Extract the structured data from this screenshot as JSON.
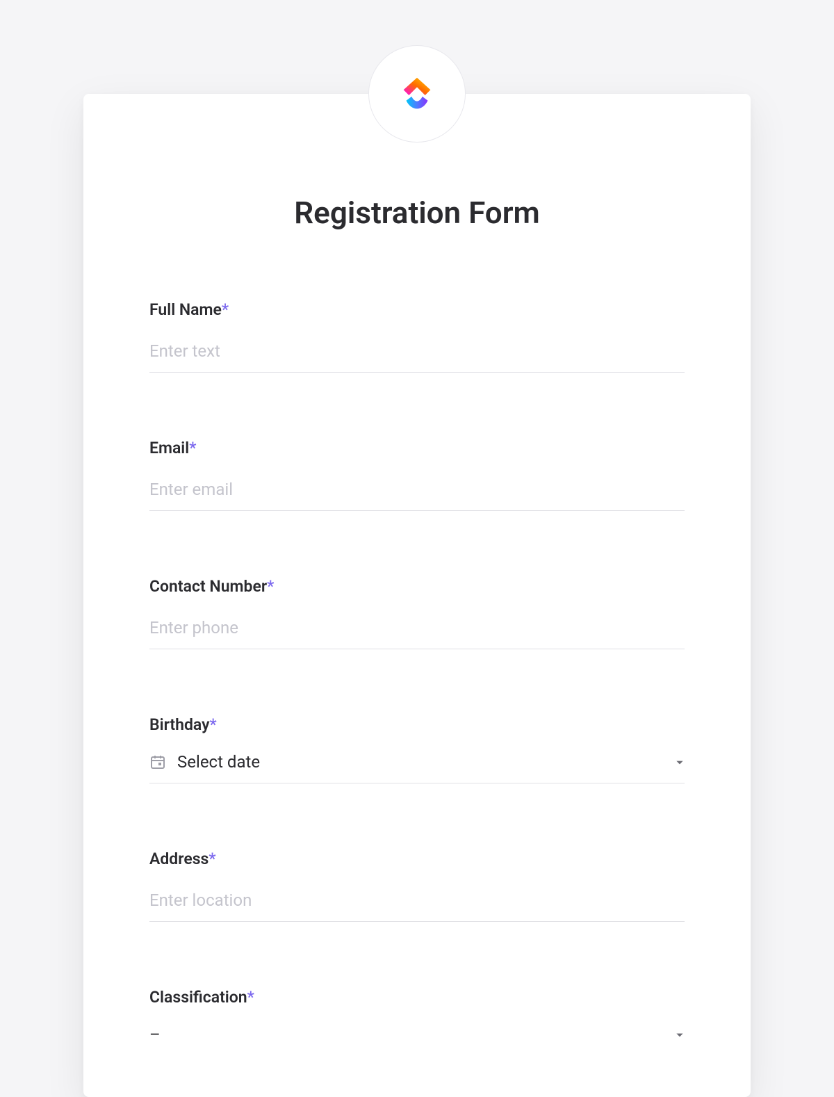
{
  "form": {
    "title": "Registration Form",
    "required_mark": "*",
    "fields": {
      "full_name": {
        "label": "Full Name",
        "placeholder": "Enter text",
        "value": ""
      },
      "email": {
        "label": "Email",
        "placeholder": "Enter email",
        "value": ""
      },
      "contact_number": {
        "label": "Contact Number",
        "placeholder": "Enter phone",
        "value": ""
      },
      "birthday": {
        "label": "Birthday",
        "placeholder": "Select date",
        "value": ""
      },
      "address": {
        "label": "Address",
        "placeholder": "Enter location",
        "value": ""
      },
      "classification": {
        "label": "Classification",
        "placeholder": "–",
        "value": ""
      }
    }
  }
}
